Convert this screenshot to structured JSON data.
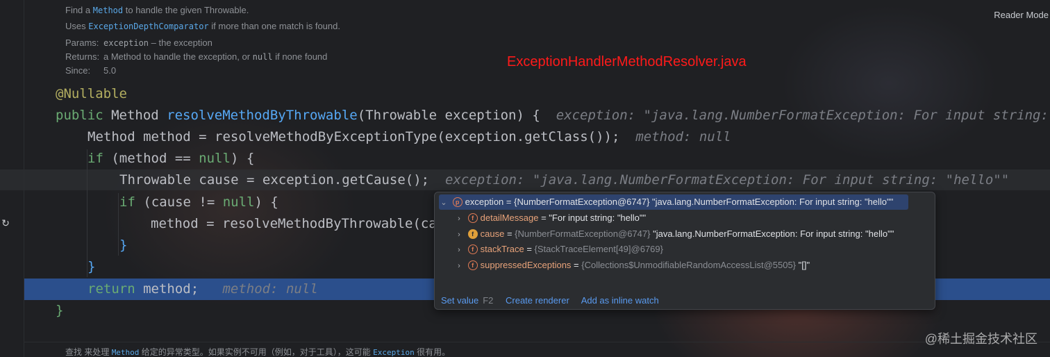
{
  "toolbar": {
    "reader_mode": "Reader Mode"
  },
  "doc": {
    "find_prefix": "Find a",
    "find_code": "Method",
    "find_suffix": "to handle the given Throwable.",
    "uses_prefix": "Uses",
    "uses_code": "ExceptionDepthComparator",
    "uses_suffix": "if more than one match is found.",
    "params_tag": "Params:",
    "params_code": "exception",
    "params_text": "– the exception",
    "returns_tag": "Returns:",
    "returns_text1": "a Method to handle the exception, or",
    "returns_code": "null",
    "returns_text2": "if none found",
    "since_tag": "Since:",
    "since_value": "5.0"
  },
  "annotation_label": "ExceptionHandlerMethodResolver.java",
  "code": {
    "l1_ann": "@Nullable",
    "l2_kw": "public",
    "l2_type": " Method ",
    "l2_fn": "resolveMethodByThrowable",
    "l2_args": "(Throwable exception) {",
    "l2_hint": "exception: \"java.lang.NumberFormatException: For input string:",
    "l3_code": "Method method = ",
    "l3_fn": "resolveMethodByExceptionType",
    "l3_rest": "(exception.getClass());",
    "l3_hint": "method: null",
    "l4_kw": "if",
    "l4_a": " (method == ",
    "l4_null": "null",
    "l4_b": ") {",
    "l5_code": "Throwable cause = exception.getCause();",
    "l5_hint": "exception: \"java.lang.NumberFormatException: For input string: \"hello\"\"",
    "l6_kw": "if",
    "l6_a": " (cause != ",
    "l6_null": "null",
    "l6_b": ") {",
    "l7_code": "method = resolveMethodByThrowable(ca",
    "l8_brace": "}",
    "l9_brace": "}",
    "l10_kw": "return",
    "l10_code": " method;",
    "l10_hint": "method: null",
    "l11_brace": "}"
  },
  "popup": {
    "rows": [
      {
        "name": "exception",
        "eq": " = ",
        "type": "{NumberFormatException@6747}",
        "value": " \"java.lang.NumberFormatException: For input string: \"hello\"\"",
        "badge": "p",
        "arrow": "⌄"
      },
      {
        "name": "detailMessage",
        "eq": " = ",
        "type": "",
        "value": "\"For input string: \"hello\"\"",
        "badge": "f",
        "arrow": "›"
      },
      {
        "name": "cause",
        "eq": " = ",
        "type": "{NumberFormatException@6747}",
        "value": " \"java.lang.NumberFormatException: For input string: \"hello\"\"",
        "badge": "f",
        "arrow": "›"
      },
      {
        "name": "stackTrace",
        "eq": " = ",
        "type": "{StackTraceElement[49]@6769}",
        "value": "",
        "badge": "f",
        "arrow": "›"
      },
      {
        "name": "suppressedExceptions",
        "eq": " = ",
        "type": "{Collections$UnmodifiableRandomAccessList@5505}",
        "value": " \"[]\"",
        "badge": "f",
        "arrow": "›"
      }
    ],
    "actions": {
      "set_value": "Set value",
      "set_value_key": "F2",
      "create_renderer": "Create renderer",
      "add_inline_watch": "Add as inline watch"
    }
  },
  "bottom_doc": {
    "t1": "查找 来处理",
    "c1": "Method",
    "t2": "给定的异常类型。如果实例不可用（例如，对于工具），这可能",
    "c2": "Exception",
    "t3": "很有用。"
  },
  "watermark": "@稀土掘金技术社区"
}
